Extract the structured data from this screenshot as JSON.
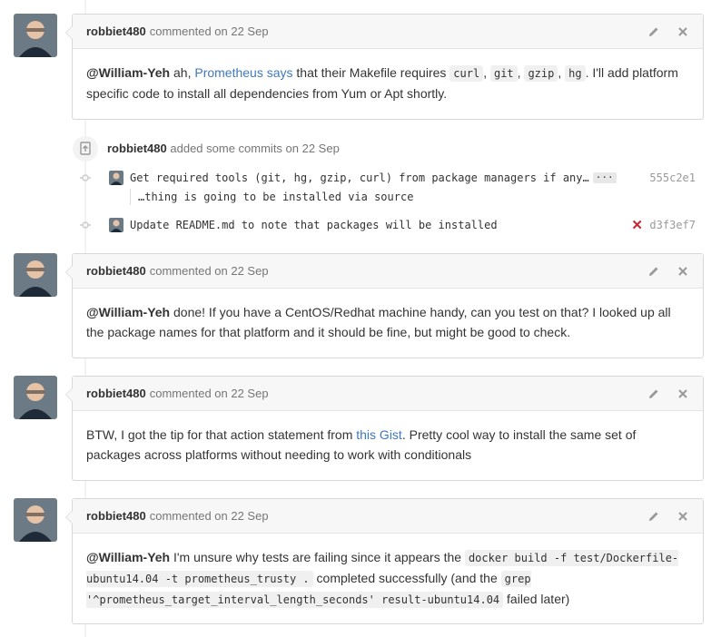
{
  "comments": [
    {
      "author": "robbiet480",
      "action": "commented on 22 Sep",
      "body": {
        "mention": "@William-Yeh",
        "t1": " ah, ",
        "link": "Prometheus says",
        "t2": " that their Makefile requires ",
        "code1": "curl",
        "sep1": ", ",
        "code2": "git",
        "sep2": ", ",
        "code3": "gzip",
        "sep3": ", ",
        "code4": "hg",
        "t3": ". I'll add platform specific code to install all dependencies from Yum or Apt shortly."
      }
    },
    {
      "author": "robbiet480",
      "action": "commented on 22 Sep",
      "body": {
        "mention": "@William-Yeh",
        "t1": " done! If you have a CentOS/Redhat machine handy, can you test on that? I looked up all the package names for that platform and it should be fine, but might be good to check."
      }
    },
    {
      "author": "robbiet480",
      "action": "commented on 22 Sep",
      "body": {
        "t1": "BTW, I got the tip for that action statement from ",
        "link": "this Gist",
        "t2": ". Pretty cool way to install the same set of packages across platforms without needing to work with conditionals"
      }
    },
    {
      "author": "robbiet480",
      "action": "commented on 22 Sep",
      "body": {
        "mention": "@William-Yeh",
        "t1": " I'm unsure why tests are failing since it appears the ",
        "code1": "docker build -f test/Dockerfile-ubuntu14.04 -t prometheus_trusty .",
        "t2": " completed successfully (and the ",
        "code2": "grep '^prometheus_target_interval_length_seconds' result-ubuntu14.04",
        "t3": " failed later)"
      }
    }
  ],
  "commit_event": {
    "author": "robbiet480",
    "action": "added some commits on 22 Sep",
    "commits": [
      {
        "message": "Get required tools (git, hg, gzip, curl) from package managers if any…",
        "ellipsis": "···",
        "extra": "…thing is going to be installed via source",
        "sha": "555c2e1",
        "status": ""
      },
      {
        "message": "Update README.md to note that packages will be installed",
        "sha": "d3f3ef7",
        "status": "✕"
      }
    ]
  },
  "colors": {
    "link": "#4078c0",
    "fail": "#cb2431",
    "header_bg": "#f7f7f7",
    "border": "#d8d8d8"
  },
  "icons": [
    "avatar",
    "pencil-icon",
    "close-icon",
    "repo-push-icon",
    "commit-dot-icon"
  ]
}
